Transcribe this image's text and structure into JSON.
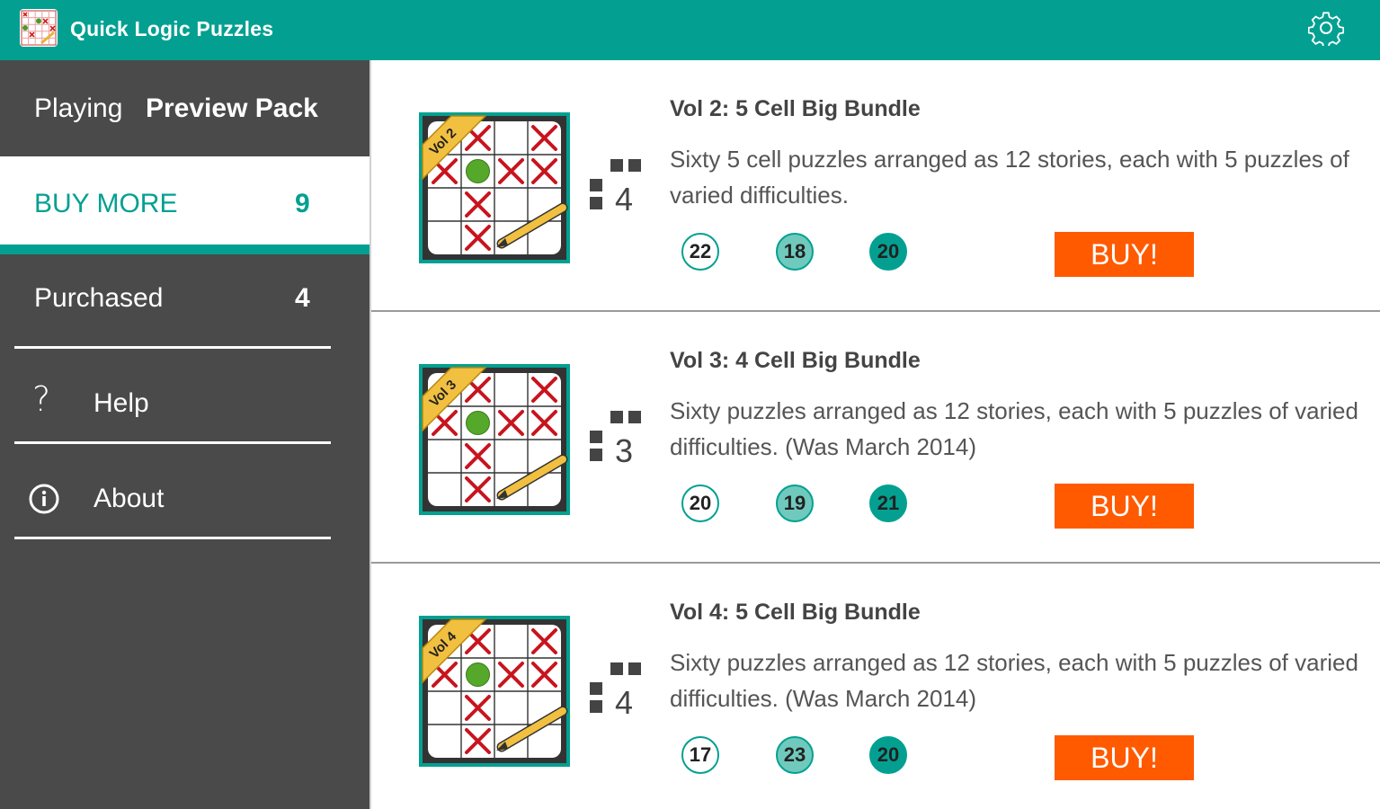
{
  "app": {
    "title": "Quick Logic Puzzles",
    "logo_icon": "puzzle-grid-icon",
    "settings_icon": "gear-icon"
  },
  "colors": {
    "primary": "#03a091",
    "sidebar_bg": "#4a4a4a",
    "buy_button": "#ff5a00",
    "badge_light": "#6fcabd"
  },
  "sidebar": {
    "playing_label": "Playing",
    "playing_value": "Preview Pack",
    "buy_more_label": "BUY MORE",
    "buy_more_count": "9",
    "purchased_label": "Purchased",
    "purchased_count": "4",
    "help_icon_glyph": "?",
    "help_label": "Help",
    "about_label": "About"
  },
  "packs": [
    {
      "ribbon": "Vol 2",
      "cells": "4",
      "title": "Vol 2: 5 Cell Big Bundle",
      "description": "Sixty 5 cell puzzles arranged as 12 stories, each with 5 puzzles of varied difficulties.",
      "badges": [
        "22",
        "18",
        "20"
      ],
      "buy_label": "BUY!"
    },
    {
      "ribbon": "Vol 3",
      "cells": "3",
      "title": "Vol 3: 4 Cell Big Bundle",
      "description": "Sixty puzzles arranged as 12 stories, each with 5 puzzles of varied difficulties. (Was March 2014)",
      "badges": [
        "20",
        "19",
        "21"
      ],
      "buy_label": "BUY!"
    },
    {
      "ribbon": "Vol 4",
      "cells": "4",
      "title": "Vol 4: 5 Cell Big Bundle",
      "description": "Sixty puzzles arranged as 12 stories, each with 5 puzzles of varied difficulties. (Was March 2014)",
      "badges": [
        "17",
        "23",
        "20"
      ],
      "buy_label": "BUY!"
    }
  ]
}
